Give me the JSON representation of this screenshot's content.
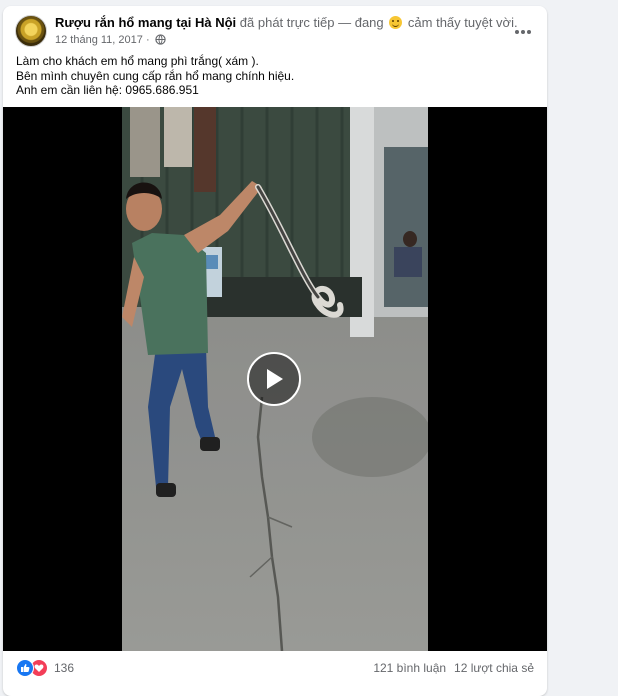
{
  "post": {
    "page_name": "Rượu rắn hổ mang tại Hà Nội",
    "activity_prefix": "đã phát trực tiếp — đang",
    "activity_suffix": "cảm thấy tuyệt vời.",
    "date": "12 tháng 11, 2017",
    "separator": "·",
    "text_lines": [
      "Làm cho khách em hổ mang phì trắng( xám ).",
      "Bên mình chuyên cung cấp rắn hổ mang chính hiệu.",
      "Anh em cần liên hệ: 0965.686.951"
    ]
  },
  "icons": {
    "more": "more-options-icon",
    "privacy": "globe-icon",
    "feeling": "smiley-icon",
    "play": "play-icon",
    "like": "like-reaction-icon",
    "love": "love-reaction-icon"
  },
  "footer": {
    "reaction_count": "136",
    "comments": "121 bình luận",
    "shares": "12 lượt chia sẻ"
  },
  "colors": {
    "background": "#f0f2f5",
    "card": "#ffffff",
    "secondary_text": "#65676b",
    "like_blue": "#1877f2",
    "love_red": "#f33e58"
  }
}
